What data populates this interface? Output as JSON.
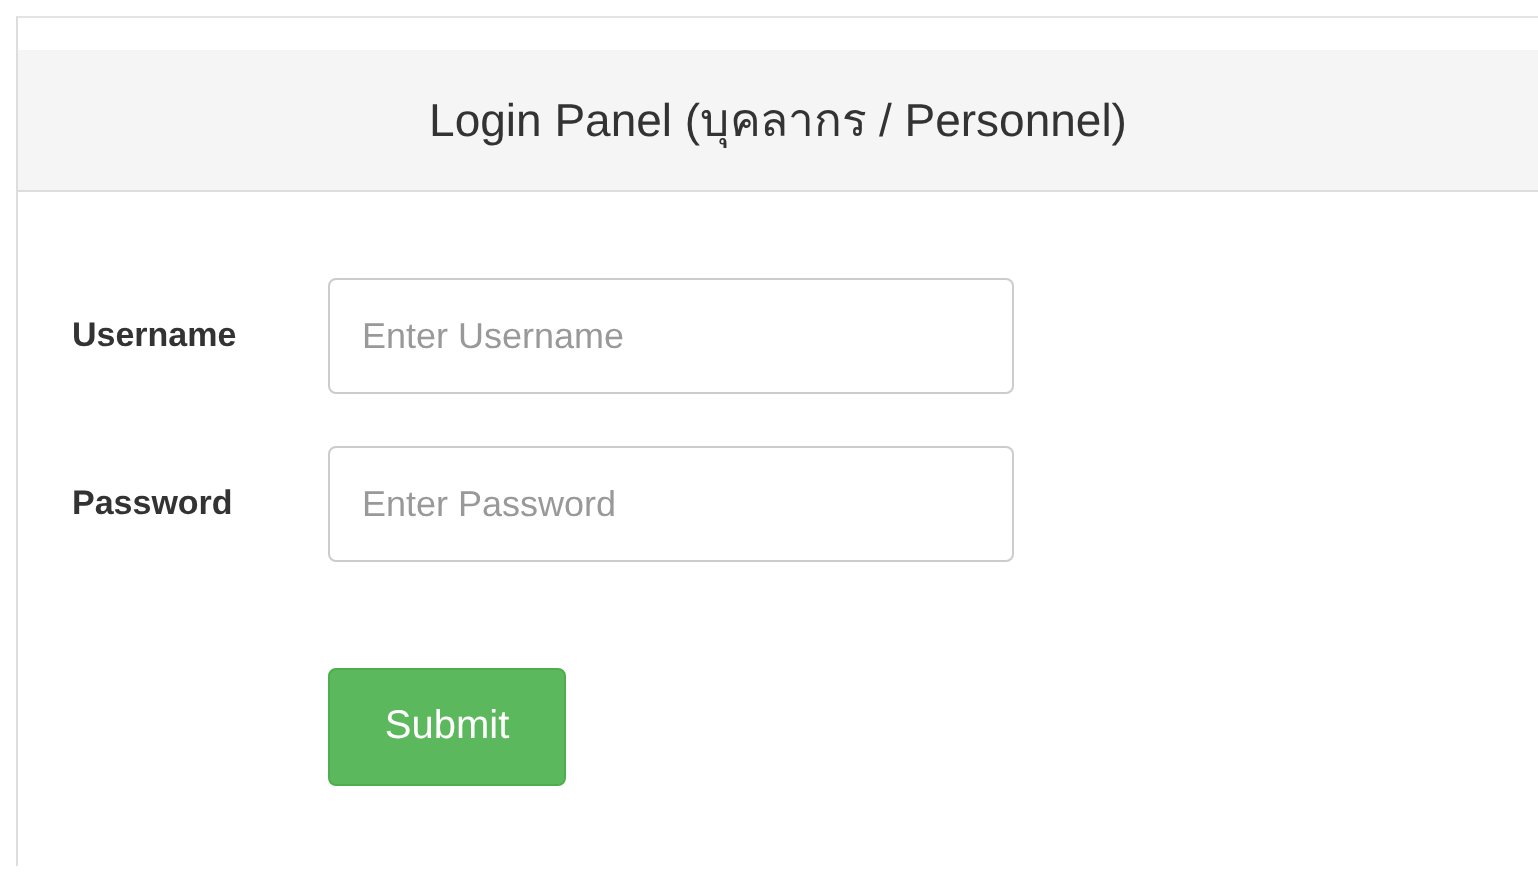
{
  "panel": {
    "title": "Login Panel (บุคลากร / Personnel)"
  },
  "fields": [
    {
      "label": "Username",
      "placeholder": "Enter Username"
    },
    {
      "label": "Password",
      "placeholder": "Enter Password"
    }
  ],
  "buttons": [
    "Submit"
  ]
}
